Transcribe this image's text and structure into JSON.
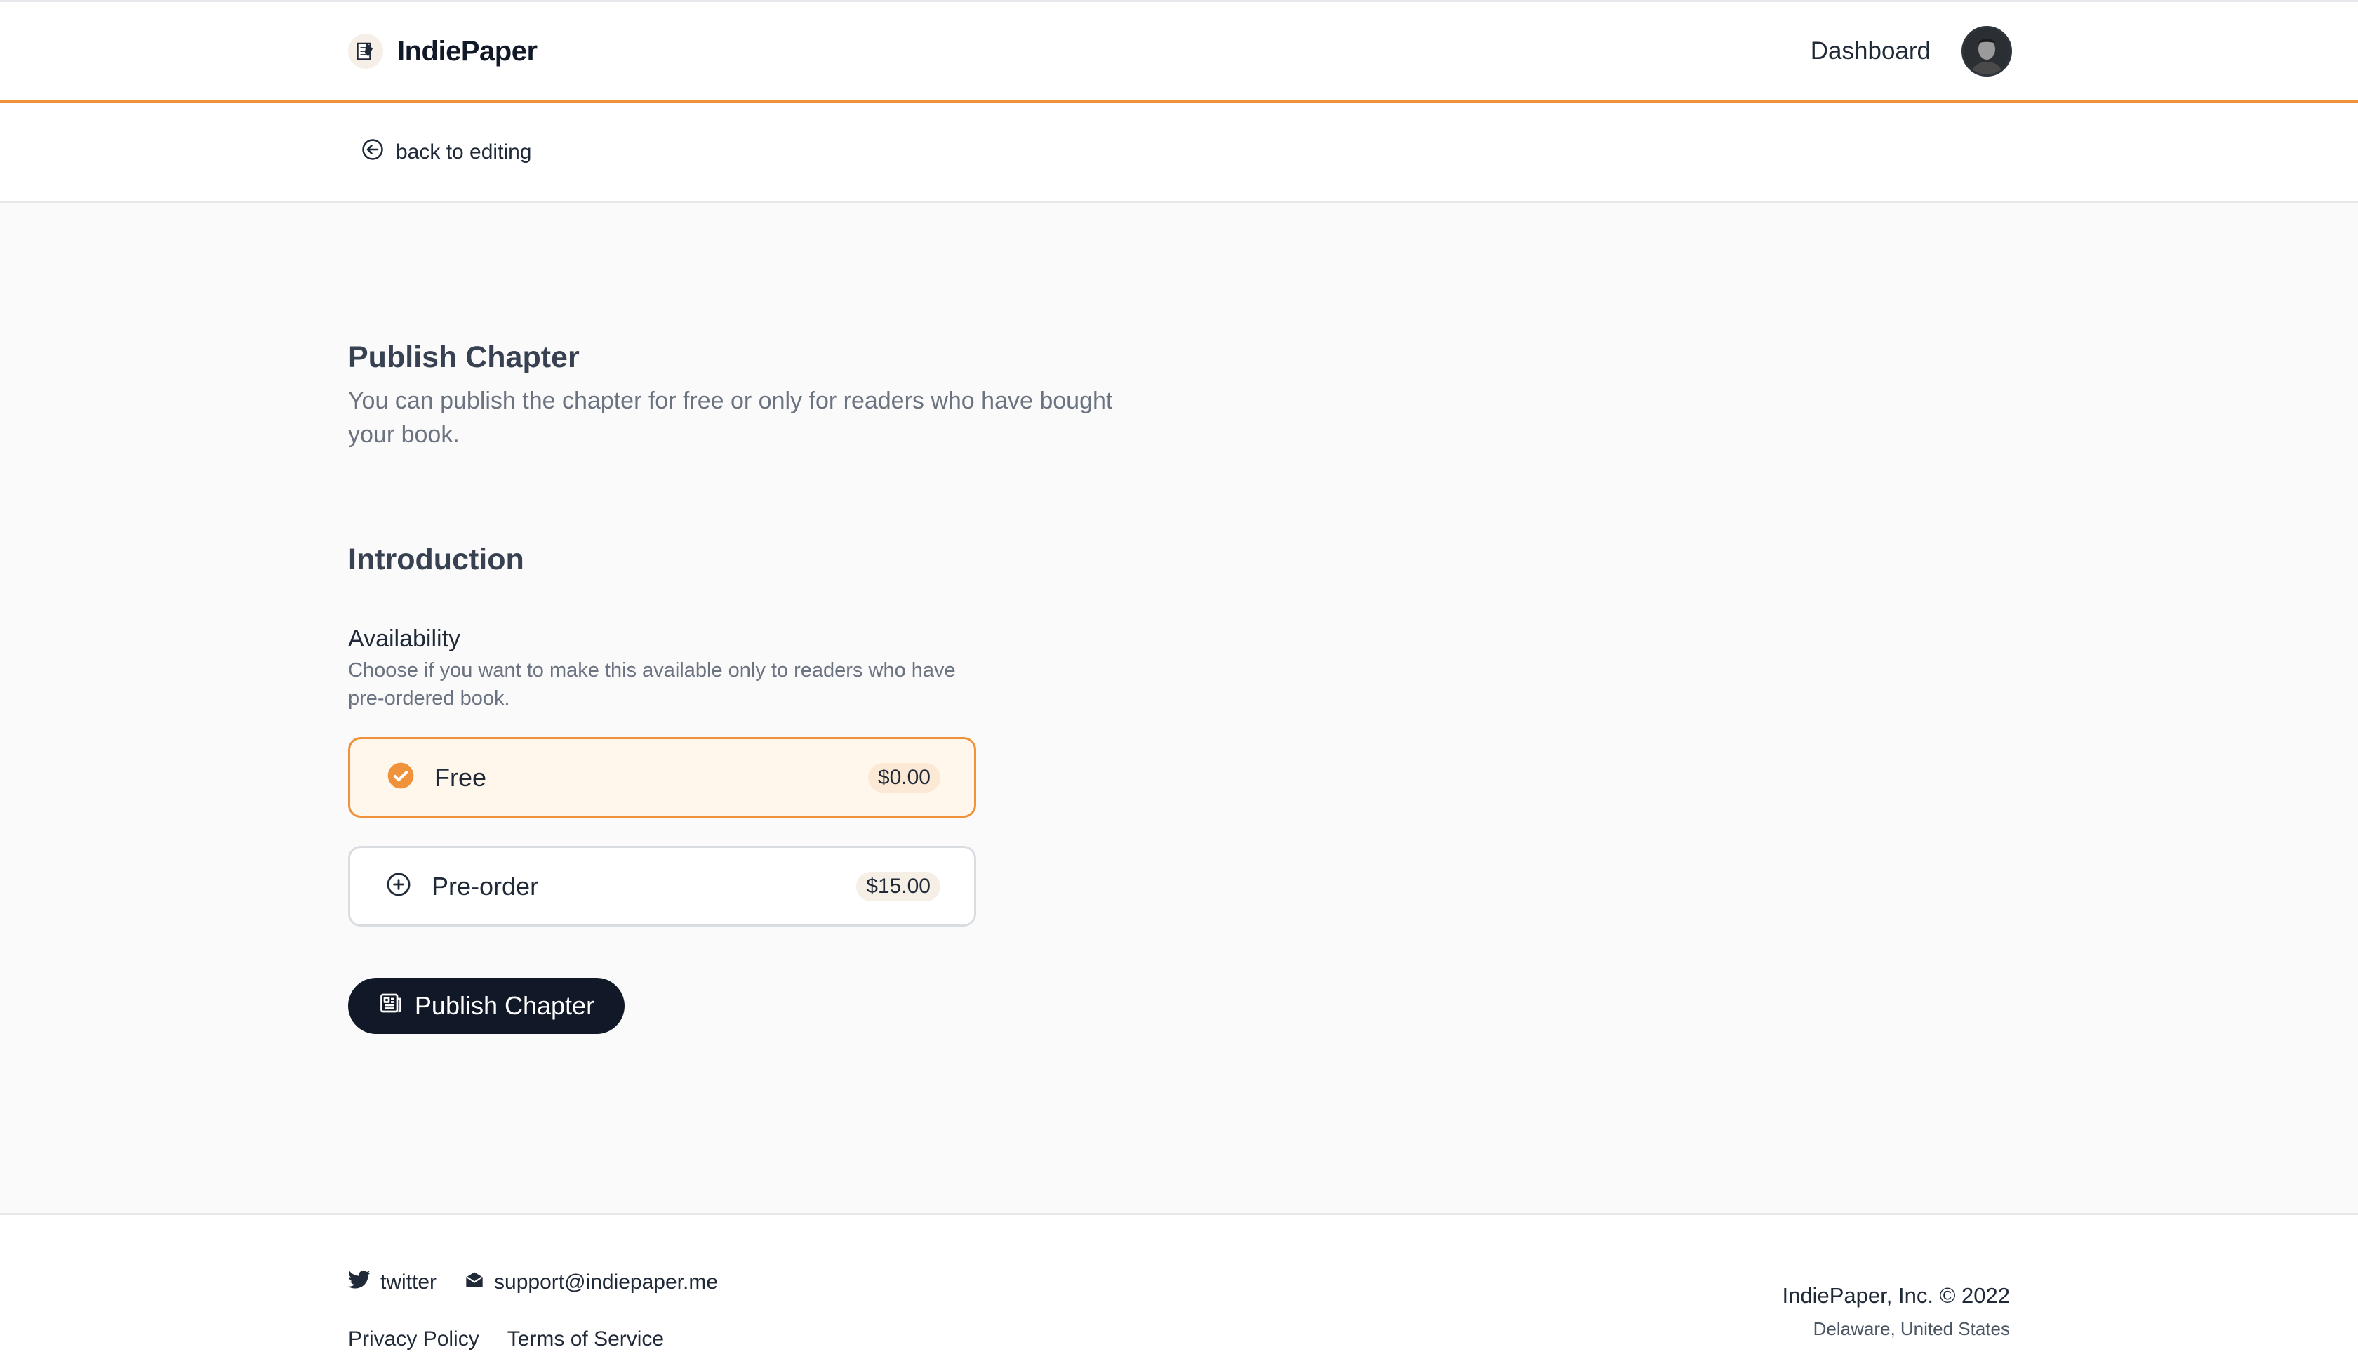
{
  "header": {
    "brand_name": "IndiePaper",
    "nav_dashboard": "Dashboard"
  },
  "backbar": {
    "back_label": "back to editing"
  },
  "main": {
    "title": "Publish Chapter",
    "description": "You can publish the chapter for free or only for readers who have bought your book.",
    "chapter_name": "Introduction",
    "availability": {
      "label": "Availability",
      "help": "Choose if you want to make this available only to readers who have pre-ordered book.",
      "options": [
        {
          "label": "Free",
          "price": "$0.00",
          "selected": true
        },
        {
          "label": "Pre-order",
          "price": "$15.00",
          "selected": false
        }
      ]
    },
    "publish_button": "Publish Chapter"
  },
  "footer": {
    "twitter": "twitter",
    "email": "support@indiepaper.me",
    "privacy": "Privacy Policy",
    "terms": "Terms of Service",
    "copyright": "IndiePaper, Inc. © 2022",
    "location": "Delaware, United States"
  },
  "colors": {
    "accent": "#f0923a",
    "dark": "#111827",
    "selected_bg": "#fff6ec"
  }
}
